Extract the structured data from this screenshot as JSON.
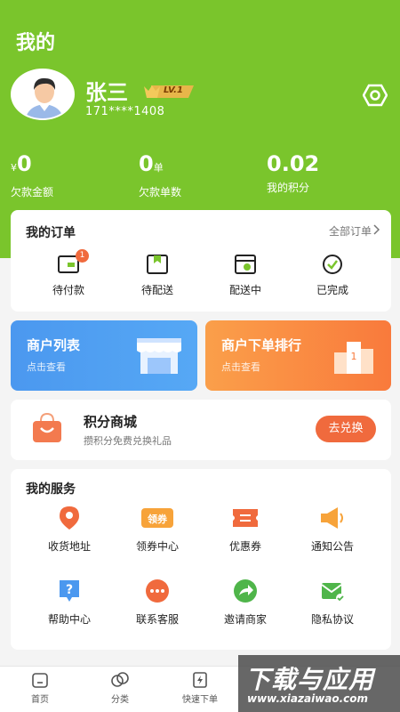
{
  "page_title": "我的",
  "user": {
    "name": "张三",
    "level": "LV.1",
    "phone": "171****1408"
  },
  "stats": [
    {
      "prefix": "¥",
      "value": "0",
      "unit": "",
      "label": "欠款金额"
    },
    {
      "prefix": "",
      "value": "0",
      "unit": "单",
      "label": "欠款单数"
    },
    {
      "prefix": "",
      "value": "0.02",
      "unit": "",
      "label": "我的积分"
    }
  ],
  "orders": {
    "title": "我的订单",
    "all_label": "全部订单",
    "items": [
      {
        "label": "待付款",
        "icon": "wallet-icon",
        "badge": "1"
      },
      {
        "label": "待配送",
        "icon": "bookmark-box-icon"
      },
      {
        "label": "配送中",
        "icon": "delivery-window-icon"
      },
      {
        "label": "已完成",
        "icon": "check-circle-icon"
      }
    ]
  },
  "promos": {
    "merchants": {
      "title": "商户列表",
      "subtitle": "点击查看",
      "icon": "storefront-icon"
    },
    "ranking": {
      "title": "商户下单排行",
      "subtitle": "点击查看",
      "icon": "podium-icon"
    }
  },
  "points_mall": {
    "title": "积分商城",
    "subtitle": "攒积分免费兑换礼品",
    "button": "去兑换",
    "icon": "shopping-bag-icon"
  },
  "services": {
    "title": "我的服务",
    "items": [
      {
        "label": "收货地址",
        "icon": "location-pin-icon"
      },
      {
        "label": "领券中心",
        "icon": "coupon-center-icon",
        "icon_text": "领券"
      },
      {
        "label": "优惠券",
        "icon": "ticket-icon"
      },
      {
        "label": "通知公告",
        "icon": "megaphone-icon"
      },
      {
        "label": "帮助中心",
        "icon": "help-icon"
      },
      {
        "label": "联系客服",
        "icon": "chat-icon"
      },
      {
        "label": "邀请商家",
        "icon": "share-icon"
      },
      {
        "label": "隐私协议",
        "icon": "privacy-icon"
      }
    ]
  },
  "tabbar": [
    {
      "label": "首页",
      "icon": "home-icon"
    },
    {
      "label": "分类",
      "icon": "category-icon"
    },
    {
      "label": "快速下单",
      "icon": "quick-order-icon"
    }
  ],
  "watermark": {
    "big": "下载与应用",
    "small": "www.xiazaiwao.com"
  },
  "colors": {
    "brand_green": "#7ac52c",
    "accent_orange": "#f06a3d",
    "blue_card": "#4b98ef",
    "orange_card": "#f97a3c"
  }
}
